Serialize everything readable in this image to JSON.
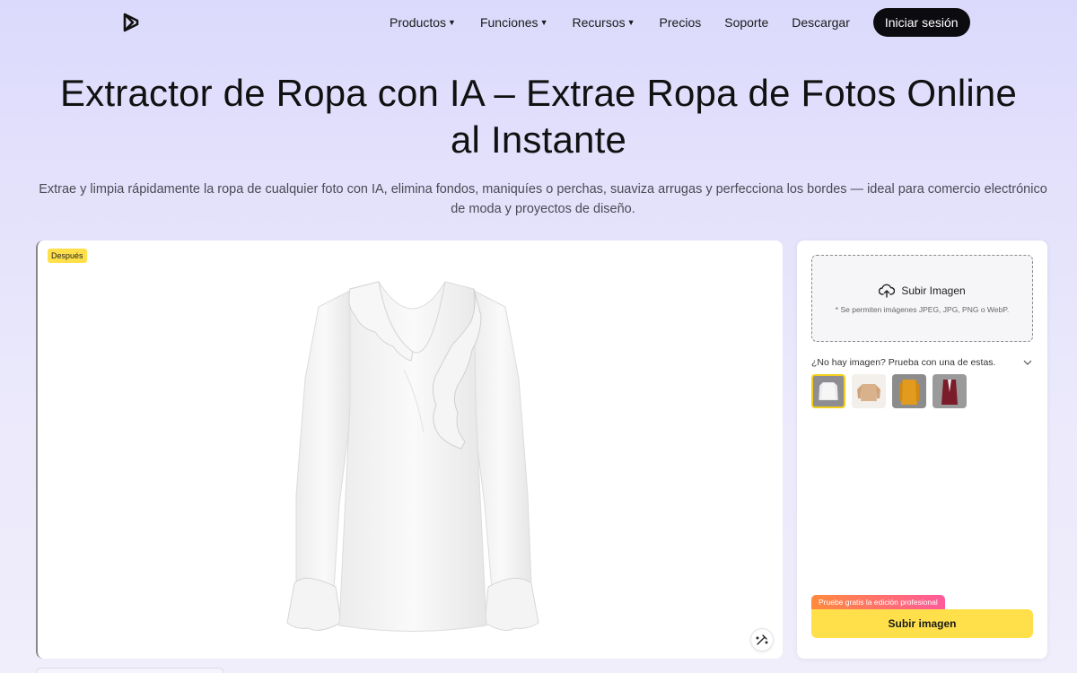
{
  "nav": {
    "items": [
      {
        "label": "Productos",
        "dropdown": true
      },
      {
        "label": "Funciones",
        "dropdown": true
      },
      {
        "label": "Recursos",
        "dropdown": true
      },
      {
        "label": "Precios",
        "dropdown": false
      },
      {
        "label": "Soporte",
        "dropdown": false
      },
      {
        "label": "Descargar",
        "dropdown": false
      }
    ],
    "login_label": "Iniciar sesión"
  },
  "hero": {
    "title_line1": "Extractor de Ropa con IA – Extrae Ropa de Fotos Online",
    "title_line2": "al Instante",
    "subtitle": "Extrae y limpia rápidamente la ropa de cualquier foto con IA, elimina fondos, maniquíes o perchas, suaviza arrugas y perfecciona los bordes — ideal para comercio electrónico de moda y proyectos de diseño."
  },
  "preview": {
    "badge": "Después",
    "image_icon": "white-blouse-image",
    "action_icon": "magic-wand-icon"
  },
  "panel": {
    "upload_label": "Subir Imagen",
    "upload_hint": "* Se permiten imágenes JPEG, JPG, PNG o WebP.",
    "samples_label": "¿No hay imagen? Prueba con una de estas.",
    "samples": [
      {
        "name": "white-blouse",
        "selected": true
      },
      {
        "name": "beige-sweater",
        "selected": false
      },
      {
        "name": "mustard-jacket",
        "selected": false
      },
      {
        "name": "burgundy-blazer",
        "selected": false
      }
    ],
    "promo_tag": "Pruebe gratis la edición profesional",
    "upload_button": "Subir imagen"
  },
  "colors": {
    "accent_yellow": "#ffe04a",
    "dark_button": "#0c0c10",
    "promo_start": "#ff8a3c",
    "promo_end": "#ff5a9a"
  }
}
